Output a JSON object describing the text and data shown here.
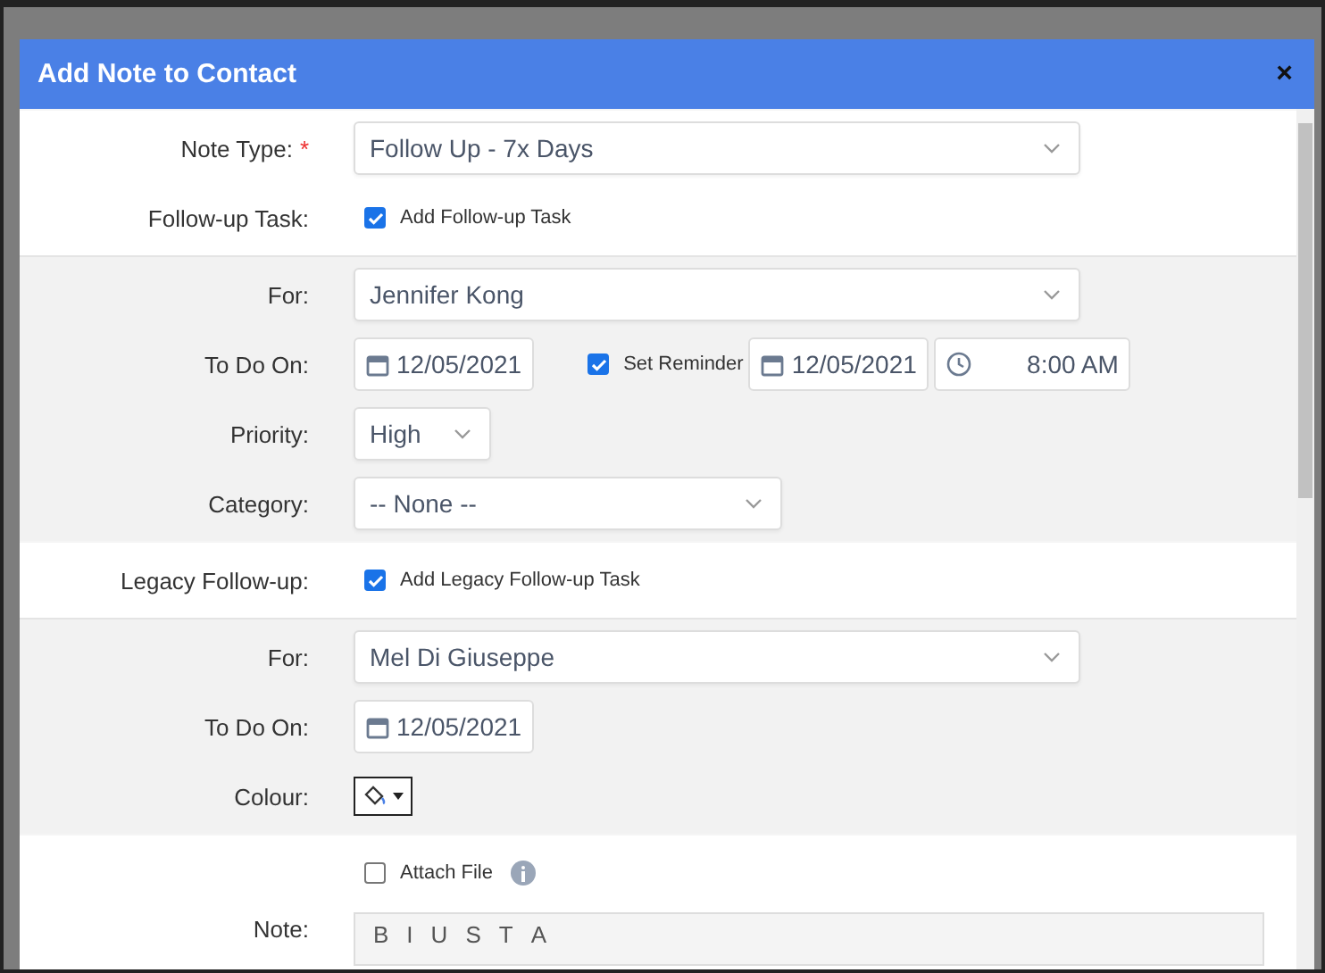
{
  "dialog": {
    "title": "Add Note to Contact",
    "close": "×"
  },
  "sections": [
    {
      "shaded": false,
      "rows": [
        {
          "kind": "select",
          "label": "Note Type:",
          "required_mark": "*",
          "value": "Follow Up - 7x Days"
        },
        {
          "kind": "checkbox",
          "label": "Follow-up Task:",
          "text": "Add Follow-up Task",
          "checked": true
        }
      ]
    },
    {
      "shaded": true,
      "rows": [
        {
          "kind": "select",
          "label": "For:",
          "value": "Jennifer Kong"
        },
        {
          "kind": "dates",
          "label": "To Do On:",
          "date": "12/05/2021",
          "reminder": {
            "text": "Set Reminder",
            "checked": true,
            "date": "12/05/2021",
            "time": "8:00 AM"
          }
        },
        {
          "kind": "short-select",
          "label": "Priority:",
          "value": "High"
        },
        {
          "kind": "mid-select",
          "label": "Category:",
          "value": "-- None --"
        }
      ]
    },
    {
      "shaded": false,
      "rows": [
        {
          "kind": "checkbox",
          "label": "Legacy Follow-up:",
          "text": "Add Legacy Follow-up Task",
          "checked": true
        }
      ]
    },
    {
      "shaded": true,
      "rows": [
        {
          "kind": "select",
          "label": "For:",
          "value": "Mel Di Giuseppe"
        },
        {
          "kind": "date",
          "label": "To Do On:",
          "date": "12/05/2021"
        },
        {
          "kind": "colour",
          "label": "Colour:"
        }
      ]
    },
    {
      "shaded": false,
      "rows": [
        {
          "kind": "attach",
          "text": "Attach File",
          "checked": false
        },
        {
          "kind": "editor",
          "label": "Note:",
          "tools": [
            "B",
            "I",
            "U",
            "S",
            "T",
            "A"
          ]
        }
      ]
    }
  ]
}
